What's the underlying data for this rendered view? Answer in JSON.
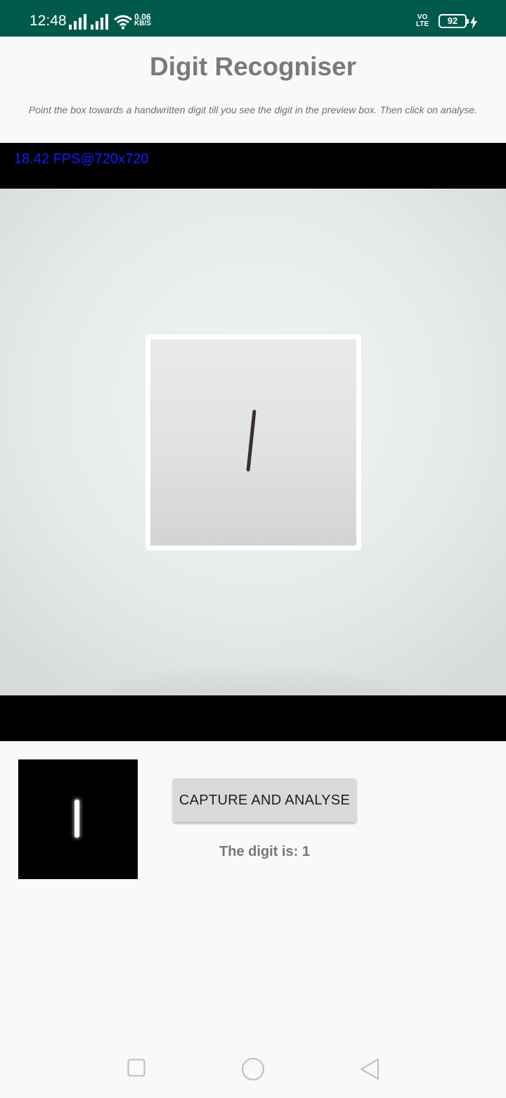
{
  "status_bar": {
    "time": "12:48",
    "net_speed_value": "0.06",
    "net_speed_unit": "KB/S",
    "volte_line1": "VO",
    "volte_line2": "LTE",
    "battery": "92",
    "icons": [
      "signal-icon",
      "signal-icon",
      "wifi-icon",
      "volte-icon",
      "battery-icon",
      "charging-icon"
    ]
  },
  "header": {
    "title": "Digit Recogniser",
    "instructions": "Point the box towards a handwritten digit till you see the digit in the preview box. Then click on analyse."
  },
  "camera": {
    "fps_label": "18.42 FPS@720x720"
  },
  "results": {
    "capture_button": "CAPTURE AND ANALYSE",
    "digit_result": "The digit is: 1"
  },
  "nav": {
    "icons": [
      "recents-icon",
      "home-icon",
      "back-icon"
    ]
  },
  "colors": {
    "status_bar": "#005a4c",
    "fps_text": "#1a1aff",
    "title_text": "#7a7a7a",
    "button_bg": "#d9d9d9"
  }
}
